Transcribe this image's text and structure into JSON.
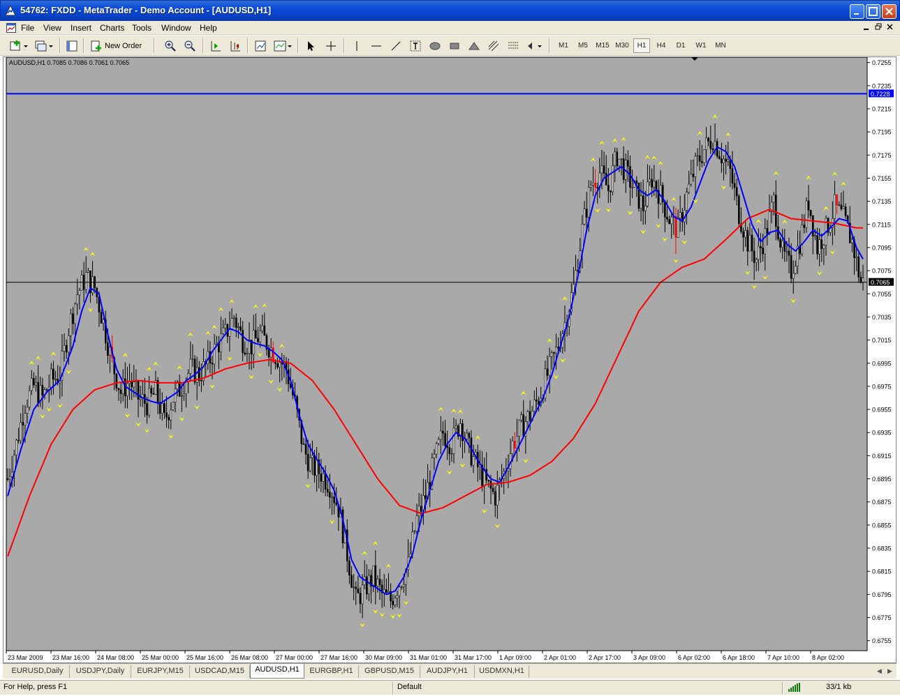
{
  "window": {
    "title": "54762: FXDD - MetaTrader - Demo Account - [AUDUSD,H1]"
  },
  "menu": [
    "File",
    "View",
    "Insert",
    "Charts",
    "Tools",
    "Window",
    "Help"
  ],
  "toolbar": {
    "new_order_label": "New Order",
    "timeframes": [
      "M1",
      "M5",
      "M15",
      "M30",
      "H1",
      "H4",
      "D1",
      "W1",
      "MN"
    ],
    "active_timeframe": "H1"
  },
  "chart": {
    "header": "AUDUSD,H1  0.7085 0.7086 0.7061 0.7065",
    "background_color": "#a9a9a9",
    "bull_color": "#000000",
    "bear_color": "#ff0000",
    "fast_ma_color": "#0000ff",
    "slow_ma_color": "#ff0000",
    "fractal_color": "#ffff00",
    "price_levels": [
      "0.7255",
      "0.7235",
      "0.7215",
      "0.7195",
      "0.7175",
      "0.7155",
      "0.7135",
      "0.7115",
      "0.7095",
      "0.7075",
      "0.7055",
      "0.7035",
      "0.7015",
      "0.6995",
      "0.6975",
      "0.6955",
      "0.6935",
      "0.6915",
      "0.6895",
      "0.6875",
      "0.6855",
      "0.6835",
      "0.6815",
      "0.6795",
      "0.6775",
      "0.6755"
    ],
    "price_max": 0.7256,
    "price_min": 0.6753,
    "time_labels": [
      "23 Mar 2009",
      "23 Mar 16:00",
      "24 Mar 08:00",
      "25 Mar 00:00",
      "25 Mar 16:00",
      "26 Mar 08:00",
      "27 Mar 00:00",
      "27 Mar 16:00",
      "30 Mar 09:00",
      "31 Mar 01:00",
      "31 Mar 17:00",
      "1 Apr 09:00",
      "2 Apr 01:00",
      "2 Apr 17:00",
      "3 Apr 09:00",
      "6 Apr 02:00",
      "6 Apr 18:00",
      "7 Apr 10:00",
      "8 Apr 02:00"
    ],
    "hline_price": 0.7228,
    "hline_label": "0.7228",
    "hline_color": "#0000ff",
    "current_price": 0.7065,
    "current_price_label": "0.7065",
    "close_points": [
      [
        0,
        0.6895
      ],
      [
        4,
        0.6925
      ],
      [
        8,
        0.696
      ],
      [
        12,
        0.6975
      ],
      [
        16,
        0.6965
      ],
      [
        20,
        0.698
      ],
      [
        24,
        0.6985
      ],
      [
        28,
        0.7025
      ],
      [
        32,
        0.7055
      ],
      [
        36,
        0.707
      ],
      [
        40,
        0.706
      ],
      [
        44,
        0.703
      ],
      [
        48,
        0.6995
      ],
      [
        52,
        0.697
      ],
      [
        56,
        0.698
      ],
      [
        60,
        0.6965
      ],
      [
        64,
        0.696
      ],
      [
        68,
        0.697
      ],
      [
        72,
        0.6945
      ],
      [
        76,
        0.6965
      ],
      [
        80,
        0.6975
      ],
      [
        84,
        0.699
      ],
      [
        88,
        0.6985
      ],
      [
        92,
        0.6995
      ],
      [
        96,
        0.701
      ],
      [
        100,
        0.702
      ],
      [
        104,
        0.7035
      ],
      [
        108,
        0.7015
      ],
      [
        112,
        0.701
      ],
      [
        116,
        0.702
      ],
      [
        120,
        0.701
      ],
      [
        124,
        0.7
      ],
      [
        128,
        0.699
      ],
      [
        132,
        0.696
      ],
      [
        136,
        0.692
      ],
      [
        140,
        0.6905
      ],
      [
        144,
        0.69
      ],
      [
        148,
        0.689
      ],
      [
        152,
        0.687
      ],
      [
        156,
        0.683
      ],
      [
        160,
        0.679
      ],
      [
        164,
        0.68
      ],
      [
        168,
        0.681
      ],
      [
        172,
        0.6795
      ],
      [
        176,
        0.679
      ],
      [
        180,
        0.6805
      ],
      [
        184,
        0.682
      ],
      [
        188,
        0.686
      ],
      [
        192,
        0.688
      ],
      [
        196,
        0.691
      ],
      [
        200,
        0.6935
      ],
      [
        204,
        0.6925
      ],
      [
        208,
        0.6945
      ],
      [
        212,
        0.692
      ],
      [
        216,
        0.6905
      ],
      [
        220,
        0.689
      ],
      [
        224,
        0.688
      ],
      [
        228,
        0.69
      ],
      [
        232,
        0.6925
      ],
      [
        236,
        0.694
      ],
      [
        240,
        0.695
      ],
      [
        244,
        0.6965
      ],
      [
        248,
        0.6985
      ],
      [
        252,
        0.7005
      ],
      [
        256,
        0.703
      ],
      [
        260,
        0.706
      ],
      [
        264,
        0.711
      ],
      [
        268,
        0.715
      ],
      [
        272,
        0.716
      ],
      [
        276,
        0.7145
      ],
      [
        280,
        0.7175
      ],
      [
        284,
        0.716
      ],
      [
        288,
        0.7145
      ],
      [
        292,
        0.713
      ],
      [
        296,
        0.7155
      ],
      [
        300,
        0.714
      ],
      [
        304,
        0.712
      ],
      [
        308,
        0.711
      ],
      [
        312,
        0.714
      ],
      [
        316,
        0.7165
      ],
      [
        320,
        0.718
      ],
      [
        324,
        0.719
      ],
      [
        328,
        0.7175
      ],
      [
        332,
        0.716
      ],
      [
        336,
        0.7125
      ],
      [
        340,
        0.71
      ],
      [
        344,
        0.7085
      ],
      [
        348,
        0.7105
      ],
      [
        352,
        0.7135
      ],
      [
        356,
        0.709
      ],
      [
        360,
        0.7075
      ],
      [
        364,
        0.71
      ],
      [
        368,
        0.7135
      ],
      [
        372,
        0.7095
      ],
      [
        376,
        0.711
      ],
      [
        380,
        0.713
      ],
      [
        384,
        0.712
      ],
      [
        388,
        0.71
      ],
      [
        392,
        0.7065
      ]
    ],
    "slow_ma_points": [
      [
        0,
        0.6828
      ],
      [
        10,
        0.688
      ],
      [
        20,
        0.6925
      ],
      [
        30,
        0.6955
      ],
      [
        40,
        0.6972
      ],
      [
        50,
        0.6978
      ],
      [
        60,
        0.698
      ],
      [
        70,
        0.6978
      ],
      [
        80,
        0.6978
      ],
      [
        90,
        0.6982
      ],
      [
        100,
        0.699
      ],
      [
        110,
        0.6995
      ],
      [
        120,
        0.6998
      ],
      [
        130,
        0.6995
      ],
      [
        140,
        0.698
      ],
      [
        150,
        0.6955
      ],
      [
        160,
        0.6925
      ],
      [
        170,
        0.6895
      ],
      [
        180,
        0.6872
      ],
      [
        190,
        0.6865
      ],
      [
        200,
        0.687
      ],
      [
        210,
        0.688
      ],
      [
        220,
        0.689
      ],
      [
        230,
        0.6892
      ],
      [
        240,
        0.6898
      ],
      [
        250,
        0.691
      ],
      [
        260,
        0.693
      ],
      [
        270,
        0.696
      ],
      [
        280,
        0.7
      ],
      [
        290,
        0.704
      ],
      [
        300,
        0.7065
      ],
      [
        310,
        0.7078
      ],
      [
        320,
        0.7085
      ],
      [
        330,
        0.7102
      ],
      [
        340,
        0.712
      ],
      [
        350,
        0.7128
      ],
      [
        360,
        0.712
      ],
      [
        370,
        0.7118
      ],
      [
        380,
        0.7116
      ],
      [
        390,
        0.7112
      ]
    ],
    "fast_ma_points": [
      [
        0,
        0.688
      ],
      [
        6,
        0.692
      ],
      [
        12,
        0.6955
      ],
      [
        18,
        0.697
      ],
      [
        24,
        0.698
      ],
      [
        30,
        0.701
      ],
      [
        34,
        0.704
      ],
      [
        38,
        0.706
      ],
      [
        42,
        0.7055
      ],
      [
        46,
        0.702
      ],
      [
        50,
        0.699
      ],
      [
        54,
        0.6975
      ],
      [
        58,
        0.697
      ],
      [
        62,
        0.6965
      ],
      [
        66,
        0.6962
      ],
      [
        70,
        0.696
      ],
      [
        74,
        0.6965
      ],
      [
        78,
        0.697
      ],
      [
        82,
        0.698
      ],
      [
        86,
        0.6985
      ],
      [
        90,
        0.6992
      ],
      [
        94,
        0.7005
      ],
      [
        98,
        0.7015
      ],
      [
        102,
        0.7025
      ],
      [
        106,
        0.7022
      ],
      [
        110,
        0.7015
      ],
      [
        114,
        0.7012
      ],
      [
        118,
        0.701
      ],
      [
        122,
        0.7005
      ],
      [
        126,
        0.6998
      ],
      [
        130,
        0.698
      ],
      [
        134,
        0.695
      ],
      [
        138,
        0.6925
      ],
      [
        142,
        0.6912
      ],
      [
        146,
        0.69
      ],
      [
        150,
        0.6885
      ],
      [
        154,
        0.686
      ],
      [
        158,
        0.6825
      ],
      [
        162,
        0.681
      ],
      [
        166,
        0.6805
      ],
      [
        170,
        0.68
      ],
      [
        174,
        0.6795
      ],
      [
        178,
        0.6798
      ],
      [
        182,
        0.681
      ],
      [
        186,
        0.683
      ],
      [
        190,
        0.686
      ],
      [
        194,
        0.6885
      ],
      [
        198,
        0.691
      ],
      [
        202,
        0.6925
      ],
      [
        206,
        0.6935
      ],
      [
        210,
        0.693
      ],
      [
        214,
        0.6918
      ],
      [
        218,
        0.6905
      ],
      [
        222,
        0.6895
      ],
      [
        226,
        0.6892
      ],
      [
        230,
        0.6905
      ],
      [
        234,
        0.692
      ],
      [
        238,
        0.6935
      ],
      [
        242,
        0.695
      ],
      [
        246,
        0.6965
      ],
      [
        250,
        0.6985
      ],
      [
        254,
        0.701
      ],
      [
        258,
        0.7035
      ],
      [
        262,
        0.707
      ],
      [
        266,
        0.711
      ],
      [
        270,
        0.714
      ],
      [
        274,
        0.7155
      ],
      [
        278,
        0.716
      ],
      [
        282,
        0.7165
      ],
      [
        286,
        0.7158
      ],
      [
        290,
        0.7145
      ],
      [
        294,
        0.714
      ],
      [
        298,
        0.7145
      ],
      [
        302,
        0.7135
      ],
      [
        306,
        0.7122
      ],
      [
        310,
        0.7118
      ],
      [
        314,
        0.713
      ],
      [
        318,
        0.715
      ],
      [
        322,
        0.717
      ],
      [
        326,
        0.7182
      ],
      [
        330,
        0.7178
      ],
      [
        334,
        0.7165
      ],
      [
        338,
        0.714
      ],
      [
        342,
        0.7115
      ],
      [
        346,
        0.71
      ],
      [
        350,
        0.7108
      ],
      [
        354,
        0.711
      ],
      [
        358,
        0.7098
      ],
      [
        362,
        0.7092
      ],
      [
        366,
        0.71
      ],
      [
        370,
        0.711
      ],
      [
        374,
        0.7105
      ],
      [
        378,
        0.7112
      ],
      [
        382,
        0.712
      ],
      [
        386,
        0.7118
      ],
      [
        390,
        0.7095
      ],
      [
        393,
        0.7085
      ]
    ],
    "candle_count": 394
  },
  "tabs": [
    "EURUSD,Daily",
    "USDJPY,Daily",
    "EURJPY,M15",
    "USDCAD,M15",
    "AUDUSD,H1",
    "EURGBP,H1",
    "GBPUSD,M15",
    "AUDJPY,H1",
    "USDMXN,H1"
  ],
  "active_tab": "AUDUSD,H1",
  "status": {
    "help": "For Help, press F1",
    "profile": "Default",
    "traffic": "33/1 kb"
  }
}
